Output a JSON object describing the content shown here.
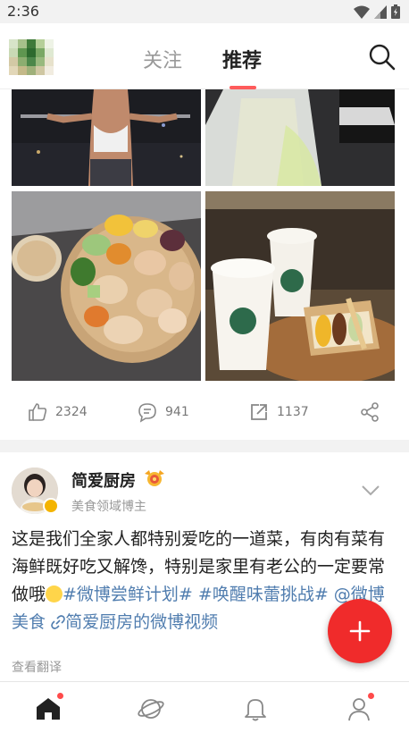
{
  "status_bar": {
    "time": "2:36"
  },
  "header": {
    "tabs": [
      {
        "label": "关注",
        "active": false
      },
      {
        "label": "推荐",
        "active": true
      }
    ]
  },
  "post1": {
    "actions": {
      "likes": "2324",
      "comments": "941",
      "reposts": "1137"
    }
  },
  "post2": {
    "author": {
      "name": "简爱厨房",
      "description": "美食领域博主"
    },
    "text": {
      "body": "这是我们全家人都特别爱吃的一道菜，有肉有菜有海鲜既好吃又解馋，特别是家里有老公的一定要常做哦",
      "hashtag1": "#微博尝鲜计划#",
      "hashtag2": "#唤醒味蕾挑战#",
      "mention": "@微博美食",
      "link": "简爱厨房的微博视频"
    },
    "translate_label": "查看翻译"
  },
  "bottom_nav": {
    "items": [
      "home",
      "discover",
      "messages",
      "profile"
    ]
  },
  "colors": {
    "accent": "#f02b2b",
    "link": "#507daf",
    "tab_indicator": "#ff5b5b"
  }
}
